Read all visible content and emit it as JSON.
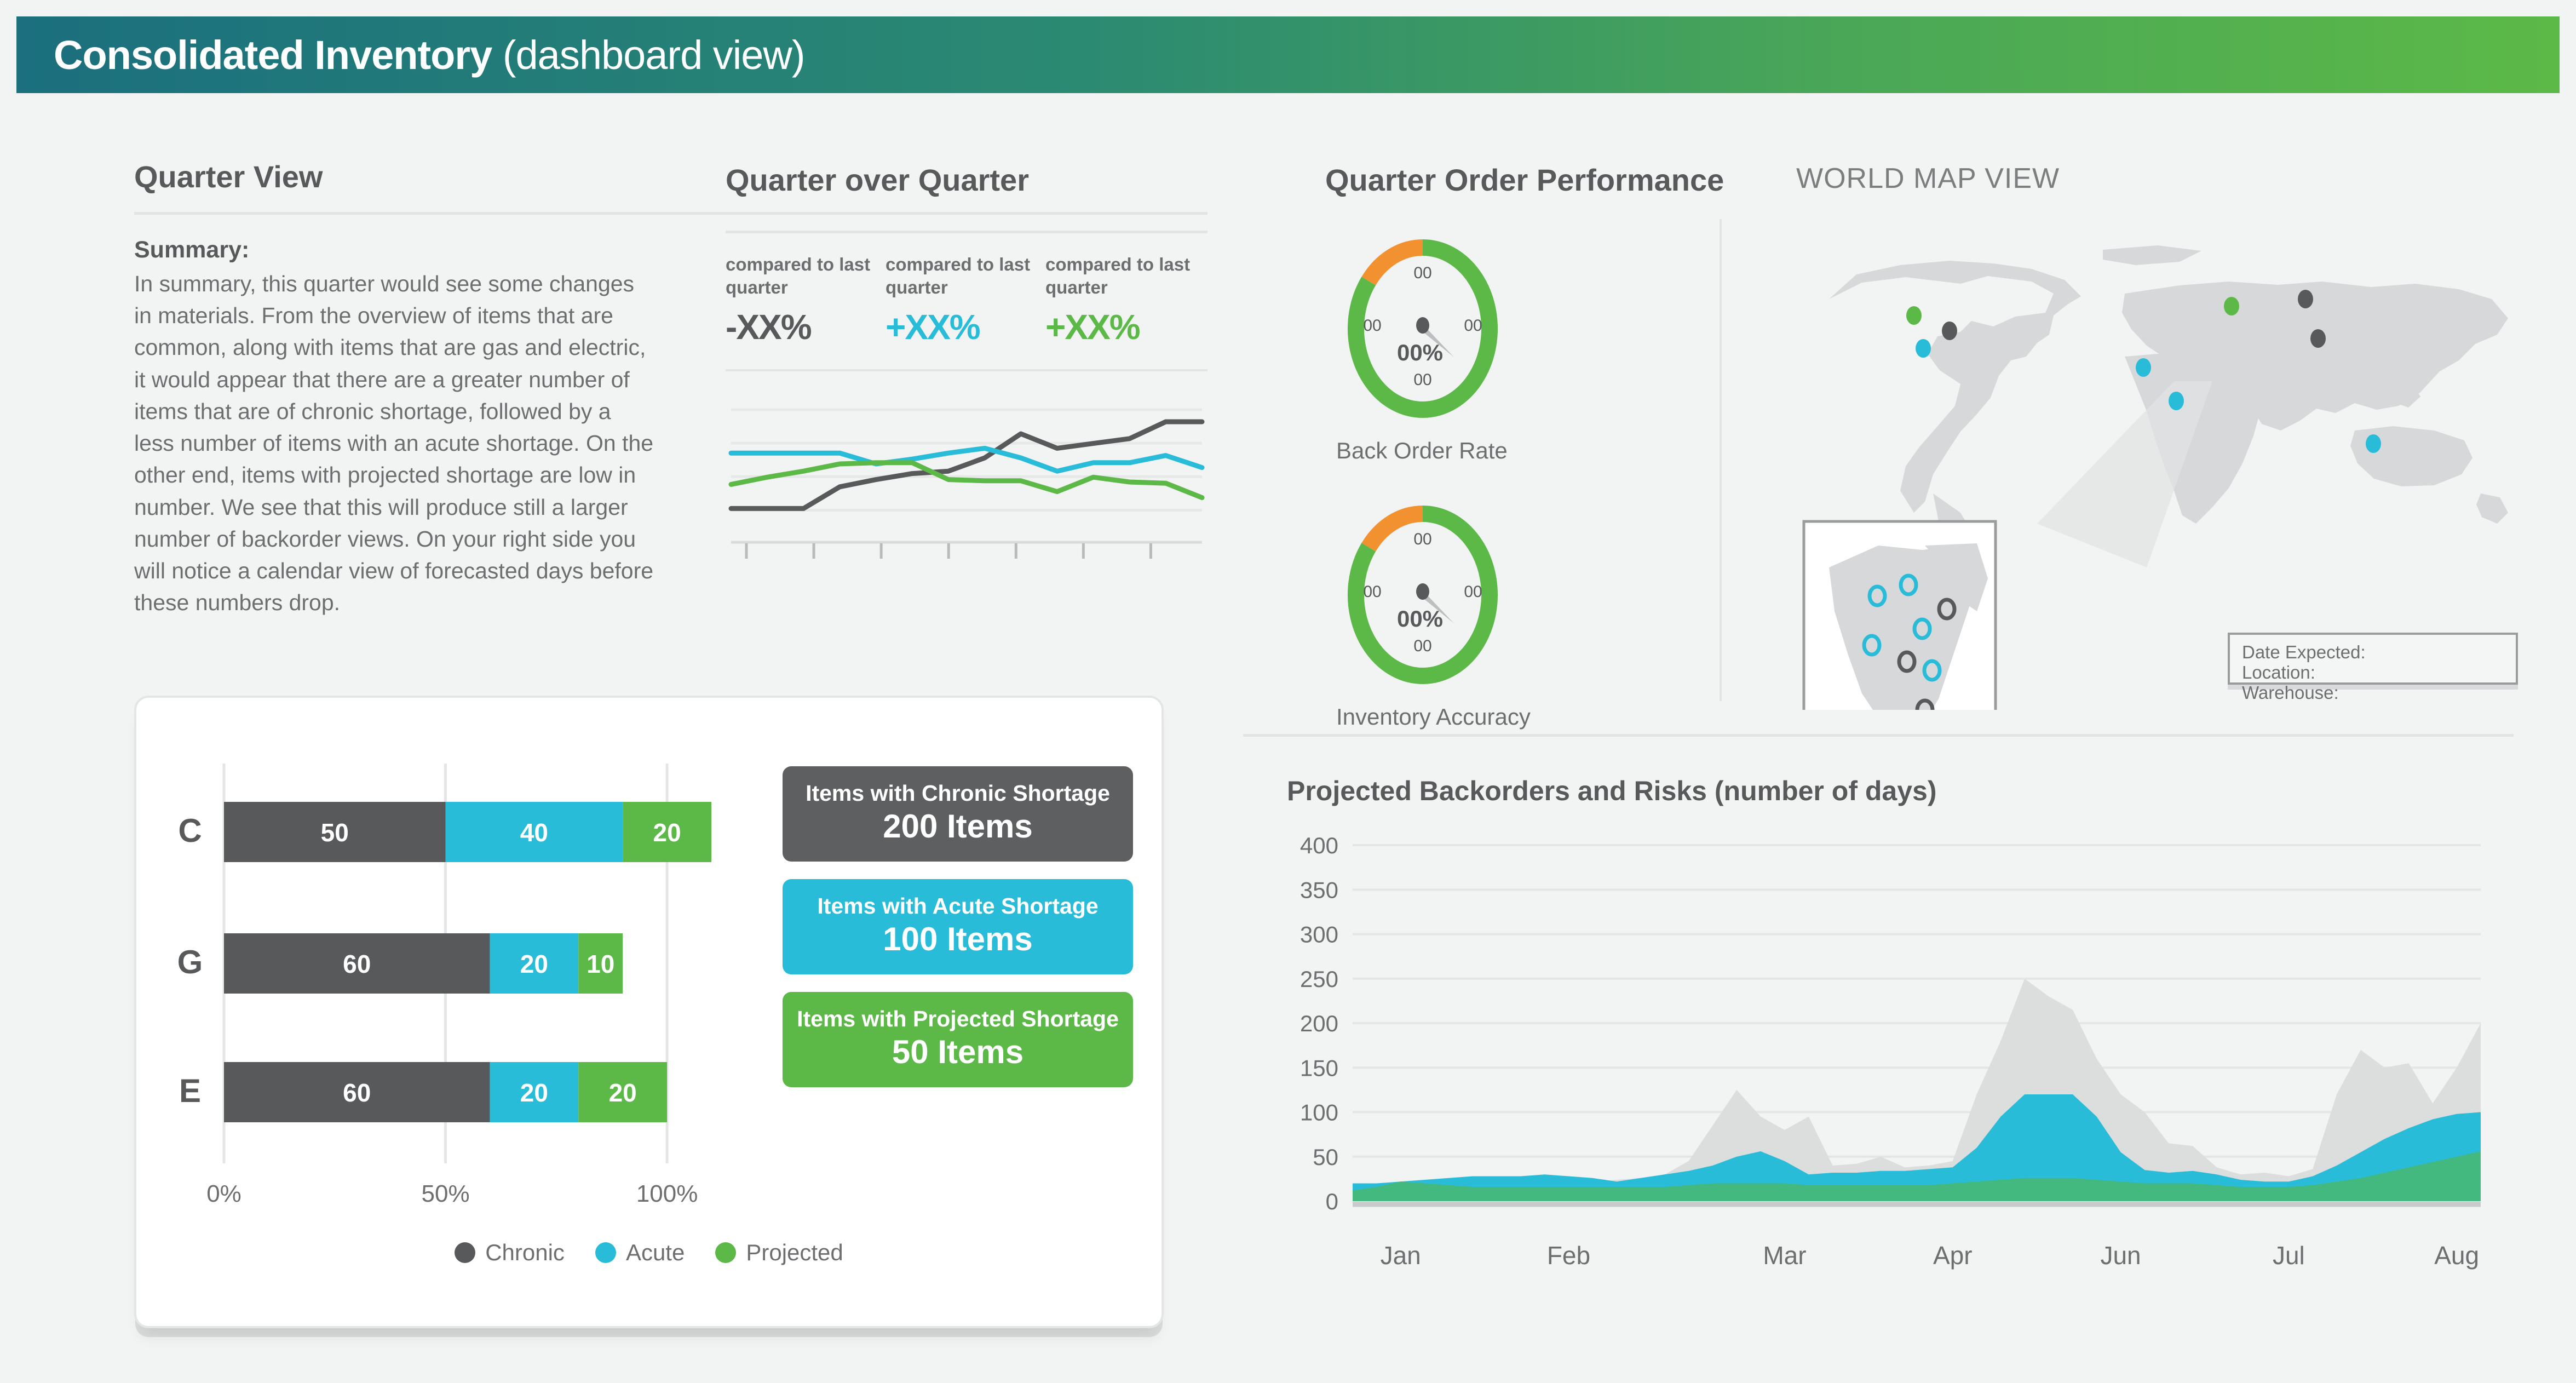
{
  "header": {
    "title_bold": "Consolidated Inventory",
    "title_light": " (dashboard view)",
    "gradient_from": "#1b6f7e",
    "gradient_to": "#5cb947"
  },
  "quarter_view": {
    "title": "Quarter View",
    "summary_heading": "Summary:",
    "summary_body": "In summary, this quarter would see some changes in materials. From the overview of items that are common, along with items that are gas and electric, it would appear that there are a greater number of items that are of chronic shortage, followed by a less number of items with an acute shortage. On the other end, items with projected shortage are low in number. We see that this will produce still a larger number of backorder views. On your right side you will notice a calendar view of forecasted days before these numbers drop."
  },
  "quarter_over_quarter": {
    "title": "Quarter over Quarter",
    "kpis": [
      {
        "label": "compared to last quarter",
        "value": "-XX%",
        "color": "#58595b"
      },
      {
        "label": "compared to last quarter",
        "value": "+XX%",
        "color": "#29bcd8"
      },
      {
        "label": "compared to last quarter",
        "value": "+XX%",
        "color": "#5cb947"
      }
    ],
    "sparkline": {
      "type": "line",
      "title": "",
      "grid": true,
      "xlabel": "",
      "ylabel": "",
      "ylim": [
        0,
        100
      ],
      "x": [
        0,
        1,
        2,
        3,
        4,
        5,
        6,
        7,
        8,
        9,
        10,
        11,
        12,
        13
      ],
      "series": [
        {
          "name": "Chronic",
          "color": "#58595b",
          "values": [
            18,
            18,
            18,
            36,
            42,
            47,
            49,
            60,
            80,
            68,
            72,
            76,
            90,
            90
          ]
        },
        {
          "name": "Acute",
          "color": "#29bcd8",
          "values": [
            64,
            64,
            64,
            64,
            55,
            59,
            64,
            68,
            60,
            49,
            56,
            56,
            62,
            52
          ]
        },
        {
          "name": "Projected",
          "color": "#5cb947",
          "values": [
            38,
            44,
            49,
            55,
            56,
            56,
            42,
            41,
            41,
            32,
            44,
            40,
            39,
            27
          ]
        }
      ]
    }
  },
  "quarter_order_performance": {
    "title": "Quarter Order Performance",
    "gauges": [
      {
        "label": "Back Order Rate",
        "center_value": "00%",
        "ticks": [
          "00",
          "00",
          "00",
          "00"
        ],
        "green_pct": 85,
        "orange_pct": 15,
        "green_color": "#5cb947",
        "orange_color": "#f2912f"
      },
      {
        "label": "Inventory Accuracy",
        "center_value": "00%",
        "ticks": [
          "00",
          "00",
          "00",
          "00"
        ],
        "green_pct": 85,
        "orange_pct": 15,
        "green_color": "#5cb947",
        "orange_color": "#f2912f"
      }
    ]
  },
  "world_map": {
    "title": "WORLD MAP VIEW",
    "info_box": {
      "line1": "Date Expected:",
      "line2": "Location:",
      "line3": "Warehouse:"
    },
    "markers": [
      {
        "x": 215,
        "y": 180,
        "color": "#5cb947"
      },
      {
        "x": 280,
        "y": 208,
        "color": "#58595b"
      },
      {
        "x": 232,
        "y": 240,
        "color": "#29bcd8"
      },
      {
        "x": 795,
        "y": 163,
        "color": "#5cb947"
      },
      {
        "x": 930,
        "y": 150,
        "color": "#58595b"
      },
      {
        "x": 953,
        "y": 222,
        "color": "#58595b"
      },
      {
        "x": 634,
        "y": 275,
        "color": "#29bcd8"
      },
      {
        "x": 694,
        "y": 336,
        "color": "#29bcd8"
      },
      {
        "x": 1054,
        "y": 414,
        "color": "#29bcd8"
      }
    ],
    "inset_markers": [
      {
        "x": 118,
        "y": 92,
        "color": "#29bcd8"
      },
      {
        "x": 175,
        "y": 72,
        "color": "#29bcd8"
      },
      {
        "x": 245,
        "y": 116,
        "color": "#58595b"
      },
      {
        "x": 200,
        "y": 152,
        "color": "#29bcd8"
      },
      {
        "x": 108,
        "y": 182,
        "color": "#29bcd8"
      },
      {
        "x": 172,
        "y": 212,
        "color": "#58595b"
      },
      {
        "x": 218,
        "y": 228,
        "color": "#29bcd8"
      },
      {
        "x": 205,
        "y": 300,
        "color": "#58595b"
      }
    ]
  },
  "shortage_panel": {
    "chart_data": {
      "type": "bar",
      "orientation": "horizontal",
      "stacked": true,
      "title": "",
      "xlabel": "",
      "ylabel": "",
      "categories": [
        "C",
        "G",
        "E"
      ],
      "xticks": [
        "0%",
        "50%",
        "100%"
      ],
      "xlim": [
        0,
        110
      ],
      "series": [
        {
          "name": "Chronic",
          "color": "#58595b",
          "values": [
            50,
            60,
            60
          ]
        },
        {
          "name": "Acute",
          "color": "#29bcd8",
          "values": [
            40,
            20,
            20
          ]
        },
        {
          "name": "Projected",
          "color": "#5cb947",
          "values": [
            20,
            10,
            20
          ]
        }
      ]
    },
    "cards": [
      {
        "title": "Items with Chronic Shortage",
        "value": "200 Items",
        "color": "#5d5f61"
      },
      {
        "title": "Items with Acute Shortage",
        "value": "100 Items",
        "color": "#29bcd8"
      },
      {
        "title": "Items with Projected Shortage",
        "value": "50 Items",
        "color": "#5cb947"
      }
    ],
    "legend": [
      {
        "label": "Chronic",
        "color": "#58595b"
      },
      {
        "label": "Acute",
        "color": "#29bcd8"
      },
      {
        "label": "Projected",
        "color": "#5cb947"
      }
    ]
  },
  "backorders": {
    "chart_data": {
      "type": "area",
      "stacked": false,
      "title": "Projected Backorders and Risks (number of days)",
      "xlabel": "",
      "ylabel": "",
      "ylim": [
        0,
        400
      ],
      "yticks": [
        0,
        50,
        100,
        150,
        200,
        250,
        300,
        350,
        400
      ],
      "grid": true,
      "month_labels": [
        "Jan",
        "Feb",
        "Mar",
        "Apr",
        "Jun",
        "Jul",
        "Aug"
      ],
      "month_positions": [
        2,
        9,
        18,
        25,
        32,
        39,
        46
      ],
      "x": [
        0,
        1,
        2,
        3,
        4,
        5,
        6,
        7,
        8,
        9,
        10,
        11,
        12,
        13,
        14,
        15,
        16,
        17,
        18,
        19,
        20,
        21,
        22,
        23,
        24,
        25,
        26,
        27,
        28,
        29,
        30,
        31,
        32,
        33,
        34,
        35,
        36,
        37,
        38,
        39,
        40,
        41,
        42,
        43,
        44,
        45,
        46,
        47
      ],
      "series": [
        {
          "name": "Risk",
          "color": "#dcdddd",
          "values": [
            18,
            20,
            22,
            22,
            22,
            24,
            26,
            28,
            28,
            22,
            22,
            24,
            26,
            30,
            45,
            85,
            125,
            95,
            80,
            95,
            40,
            42,
            50,
            38,
            40,
            45,
            120,
            180,
            250,
            230,
            215,
            160,
            120,
            100,
            65,
            62,
            38,
            30,
            32,
            28,
            36,
            120,
            170,
            150,
            155,
            110,
            150,
            200
          ]
        },
        {
          "name": "Acute",
          "color": "#29bcd8",
          "values": [
            20,
            20,
            22,
            24,
            26,
            28,
            28,
            28,
            30,
            28,
            26,
            22,
            26,
            30,
            34,
            40,
            50,
            56,
            45,
            30,
            32,
            32,
            34,
            34,
            36,
            38,
            60,
            95,
            120,
            120,
            120,
            95,
            55,
            35,
            32,
            34,
            30,
            24,
            22,
            22,
            28,
            40,
            55,
            70,
            82,
            92,
            98,
            100
          ]
        },
        {
          "name": "Projected",
          "color": "#43b97f",
          "values": [
            12,
            16,
            22,
            20,
            18,
            16,
            16,
            16,
            16,
            16,
            16,
            16,
            16,
            16,
            18,
            20,
            20,
            20,
            20,
            18,
            18,
            18,
            18,
            18,
            18,
            20,
            22,
            24,
            26,
            26,
            26,
            24,
            22,
            20,
            20,
            20,
            18,
            16,
            16,
            16,
            18,
            22,
            26,
            32,
            38,
            44,
            50,
            56
          ]
        }
      ]
    }
  }
}
